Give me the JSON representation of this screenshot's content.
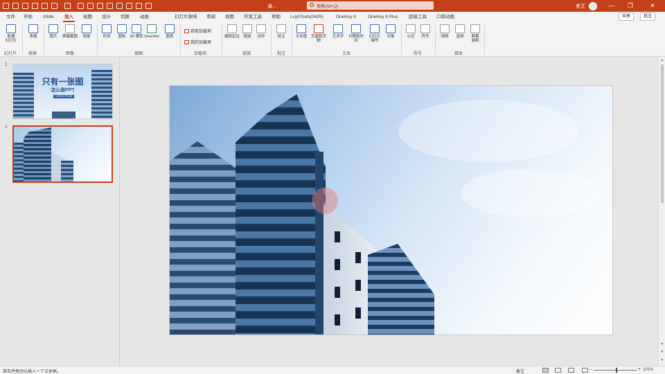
{
  "titlebar": {
    "qat_items": [
      "",
      "",
      "",
      "",
      "",
      "",
      "",
      "",
      "",
      "",
      "",
      "",
      "",
      "",
      "",
      "",
      ""
    ],
    "qat_labels": [
      "",
      "",
      "",
      "",
      "",
      "",
      "",
      "",
      "",
      ""
    ],
    "doc_title": "演...",
    "search_placeholder": "搜索(Alt+Q)",
    "user_name": "老王",
    "accent_color": "#c4401b"
  },
  "tabs": [
    {
      "label": "文件"
    },
    {
      "label": "开始"
    },
    {
      "label": "iSlide"
    },
    {
      "label": "插入",
      "active": true
    },
    {
      "label": "绘图"
    },
    {
      "label": "设计"
    },
    {
      "label": "切换"
    },
    {
      "label": "动画"
    },
    {
      "label": "幻灯片放映"
    },
    {
      "label": "审阅"
    },
    {
      "label": "视图"
    },
    {
      "label": "开发工具"
    },
    {
      "label": "帮助"
    },
    {
      "label": "LvyhTools(0429)"
    },
    {
      "label": "OneKey 8"
    },
    {
      "label": "OneKey 8 Plus"
    },
    {
      "label": "超级工具"
    },
    {
      "label": "口袋动画"
    }
  ],
  "share_label": "共享",
  "comment_label": "批注",
  "ribbon": {
    "buttons": [
      {
        "label": "新建\n幻灯片"
      },
      {
        "label": "表格"
      },
      {
        "label": "图片"
      },
      {
        "label": "屏幕截图"
      },
      {
        "label": "相册"
      },
      {
        "label": "形状"
      },
      {
        "label": "图标"
      },
      {
        "label": "3D 模型"
      },
      {
        "label": "SmartArt"
      },
      {
        "label": "图表"
      },
      {
        "label": "缩放定位"
      },
      {
        "label": "链接"
      },
      {
        "label": "动作"
      },
      {
        "label": "批注"
      },
      {
        "label": "文本框"
      },
      {
        "label": "页眉和页脚"
      },
      {
        "label": "艺术字"
      },
      {
        "label": "日期和时间"
      },
      {
        "label": "幻灯片\n编号"
      },
      {
        "label": "对象"
      },
      {
        "label": "公式"
      },
      {
        "label": "符号"
      },
      {
        "label": "视频"
      },
      {
        "label": "音频"
      },
      {
        "label": "屏幕\n录制"
      }
    ],
    "addin_get": "获取加载项",
    "addin_mine": "我的加载项",
    "groups": [
      "幻灯片",
      "表格",
      "图像",
      "插图",
      "加载项",
      "链接",
      "批注",
      "文本",
      "符号",
      "媒体"
    ]
  },
  "slides": [
    {
      "number": "1",
      "title": "只有一张图",
      "subtitle": "怎么做PPT",
      "tag": "LOREM IPSUM"
    },
    {
      "number": "2"
    }
  ],
  "status": {
    "left_text": "单击并拖动以插入一个文本框。",
    "notes": "备注",
    "zoom": "101%"
  }
}
